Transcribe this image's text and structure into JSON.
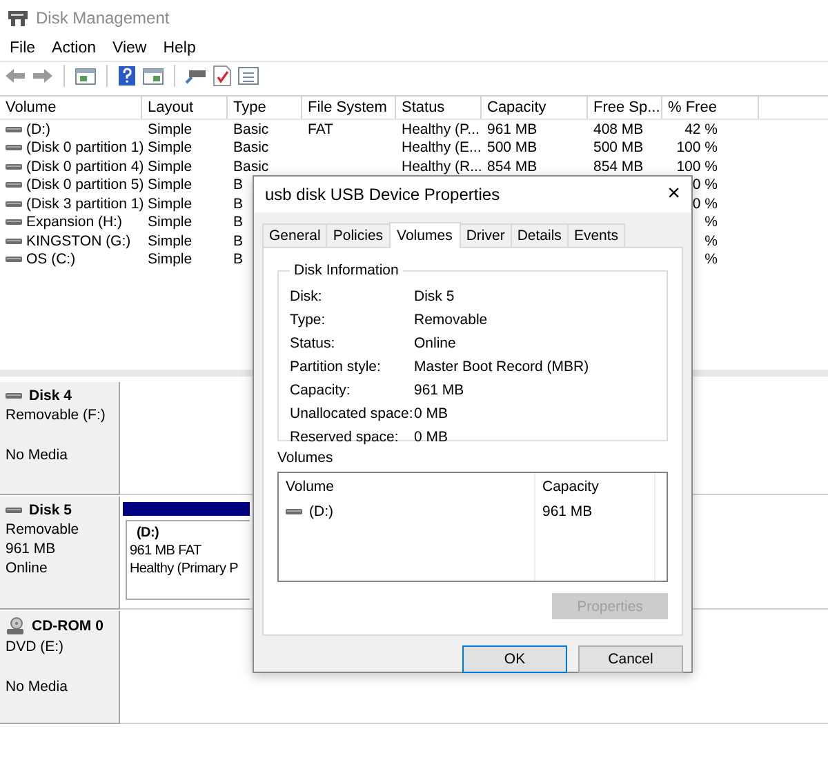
{
  "window": {
    "title": "Disk Management"
  },
  "menu": [
    "File",
    "Action",
    "View",
    "Help"
  ],
  "volume_table": {
    "columns": [
      "Volume",
      "Layout",
      "Type",
      "File System",
      "Status",
      "Capacity",
      "Free Sp...",
      "% Free"
    ],
    "rows": [
      {
        "volume": "(D:)",
        "layout": "Simple",
        "type": "Basic",
        "file_system": "FAT",
        "status": "Healthy (P...",
        "capacity": "961 MB",
        "free_space": "408 MB",
        "percent_free": "42 %"
      },
      {
        "volume": "(Disk 0 partition 1)",
        "layout": "Simple",
        "type": "Basic",
        "status": "Healthy (E...",
        "capacity": "500 MB",
        "free_space": "500 MB",
        "percent_free": "100 %"
      },
      {
        "volume": "(Disk 0 partition 4)",
        "layout": "Simple",
        "type": "Basic",
        "status": "Healthy (R...",
        "capacity": "854 MB",
        "free_space": "854 MB",
        "percent_free": "100 %"
      },
      {
        "volume": "(Disk 0 partition 5)",
        "layout": "Simple",
        "type": "B",
        "percent_free": "0 %"
      },
      {
        "volume": "(Disk 3 partition 1)",
        "layout": "Simple",
        "type": "B",
        "percent_free": "0 %"
      },
      {
        "volume": "Expansion (H:)",
        "layout": "Simple",
        "type": "B",
        "percent_free": "%"
      },
      {
        "volume": "KINGSTON (G:)",
        "layout": "Simple",
        "type": "B",
        "percent_free": "%"
      },
      {
        "volume": "OS (C:)",
        "layout": "Simple",
        "type": "B",
        "percent_free": "%"
      }
    ]
  },
  "disks": [
    {
      "kind": "disk",
      "name": "Disk 4",
      "type": "Removable (F:)",
      "status": "No Media"
    },
    {
      "kind": "disk",
      "name": "Disk 5",
      "type": "Removable",
      "size": "961 MB",
      "status": "Online",
      "partitions": [
        {
          "name": "(D:)",
          "detail": "961 MB FAT",
          "status": "Healthy (Primary P"
        }
      ]
    },
    {
      "kind": "cdrom",
      "name": "CD-ROM 0",
      "type": "DVD (E:)",
      "status": "No Media"
    }
  ],
  "dialog": {
    "title": "usb disk USB Device Properties",
    "close": "×",
    "tabs": [
      {
        "label": "General",
        "selected": false
      },
      {
        "label": "Policies",
        "selected": false
      },
      {
        "label": "Volumes",
        "selected": true
      },
      {
        "label": "Driver",
        "selected": false
      },
      {
        "label": "Details",
        "selected": false
      },
      {
        "label": "Events",
        "selected": false
      }
    ],
    "group_title": "Disk Information",
    "fields": [
      {
        "label": "Disk:",
        "value": "Disk 5"
      },
      {
        "label": "Type:",
        "value": "Removable"
      },
      {
        "label": "Status:",
        "value": "Online"
      },
      {
        "label": "Partition style:",
        "value": "Master Boot Record (MBR)"
      },
      {
        "label": "Capacity:",
        "value": "961 MB"
      },
      {
        "label": "Unallocated space:",
        "value": "0 MB"
      },
      {
        "label": "Reserved space:",
        "value": "0 MB"
      }
    ],
    "volumes_label": "Volumes",
    "volume_columns": [
      "Volume",
      "Capacity"
    ],
    "volume_rows": [
      {
        "volume": "(D:)",
        "capacity": "961 MB"
      }
    ],
    "properties_button": {
      "label": "Properties",
      "disabled": true
    },
    "buttons": [
      {
        "label": "OK",
        "default": true
      },
      {
        "label": "Cancel",
        "default": false
      }
    ]
  }
}
